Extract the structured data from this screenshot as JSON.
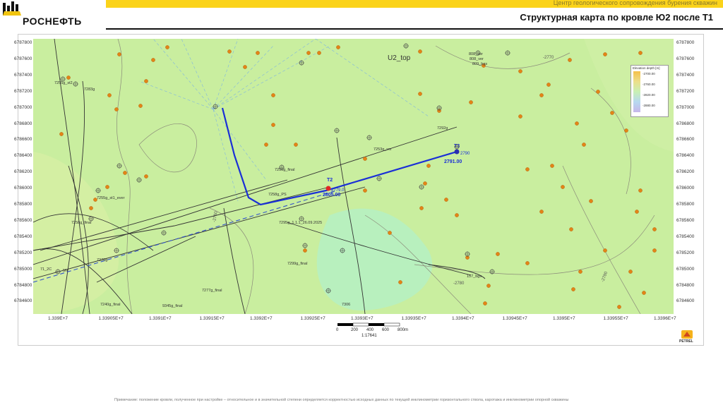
{
  "header": {
    "top_strip_text": "Центр геологического сопровождения бурения скважин",
    "logo_text": "РОСНЕФТЬ",
    "title": "Структурная карта по кровле Ю2 после Т1"
  },
  "map": {
    "surface_label": "U2_top",
    "y_ticks": [
      "6787800",
      "6787600",
      "6787400",
      "6787200",
      "6787000",
      "6786800",
      "6786600",
      "6786400",
      "6786200",
      "6786000",
      "6785800",
      "6785600",
      "6785400",
      "6785200",
      "6785000",
      "6784800",
      "6784600"
    ],
    "x_ticks": [
      "1.339E+7",
      "1.33905E+7",
      "1.3391E+7",
      "1.33915E+7",
      "1.3392E+7",
      "1.33925E+7",
      "1.3393E+7",
      "1.33935E+7",
      "1.3394E+7",
      "1.33945E+7",
      "1.3395E+7",
      "1.33955E+7",
      "1.3396E+7"
    ],
    "scale_ticks": [
      "0",
      "200",
      "400",
      "600",
      "800m"
    ],
    "scale_ratio": "1:17641",
    "contours": [
      "-2770",
      "-2780",
      "-2780",
      "-2780"
    ],
    "targets": [
      {
        "name": "T2",
        "depth": "2779.0",
        "tvd": "2805.00"
      },
      {
        "name": "T3",
        "depth": "2790",
        "tvd": "2791.00"
      }
    ],
    "wells": [
      "7255g_st2",
      "7283g",
      "7253g_ver",
      "7292g",
      "808_ver",
      "808_ver",
      "809_bgs",
      "7255g_st1_ever",
      "7258g_final",
      "7270g",
      "7256g_final",
      "7258g_PS",
      "7295g_1.1.1_26.09.2025",
      "7299g_final",
      "7277g_final",
      "7240g_final",
      "9345g_final",
      "7306",
      "157_bgs",
      "71_2C",
      "5N"
    ]
  },
  "legend": {
    "title": "Elevation depth [m]",
    "values": [
      "-2700.00",
      "-2760.00",
      "-2820.00",
      "-2880.00"
    ]
  },
  "logo_petrel": "PETREL",
  "footnote": "Примечание: положение кровли, полученное при настройке – относительное и в значительной степени определяется корректностью исходных данных по текущей инклинометрии горизонтального ствола, каротажа и инклинометрии опорной скважины",
  "colors": {
    "accent_yellow": "#fbd31a",
    "map_green": "#c9ee9f",
    "trajectory": "#1a2fd6"
  }
}
